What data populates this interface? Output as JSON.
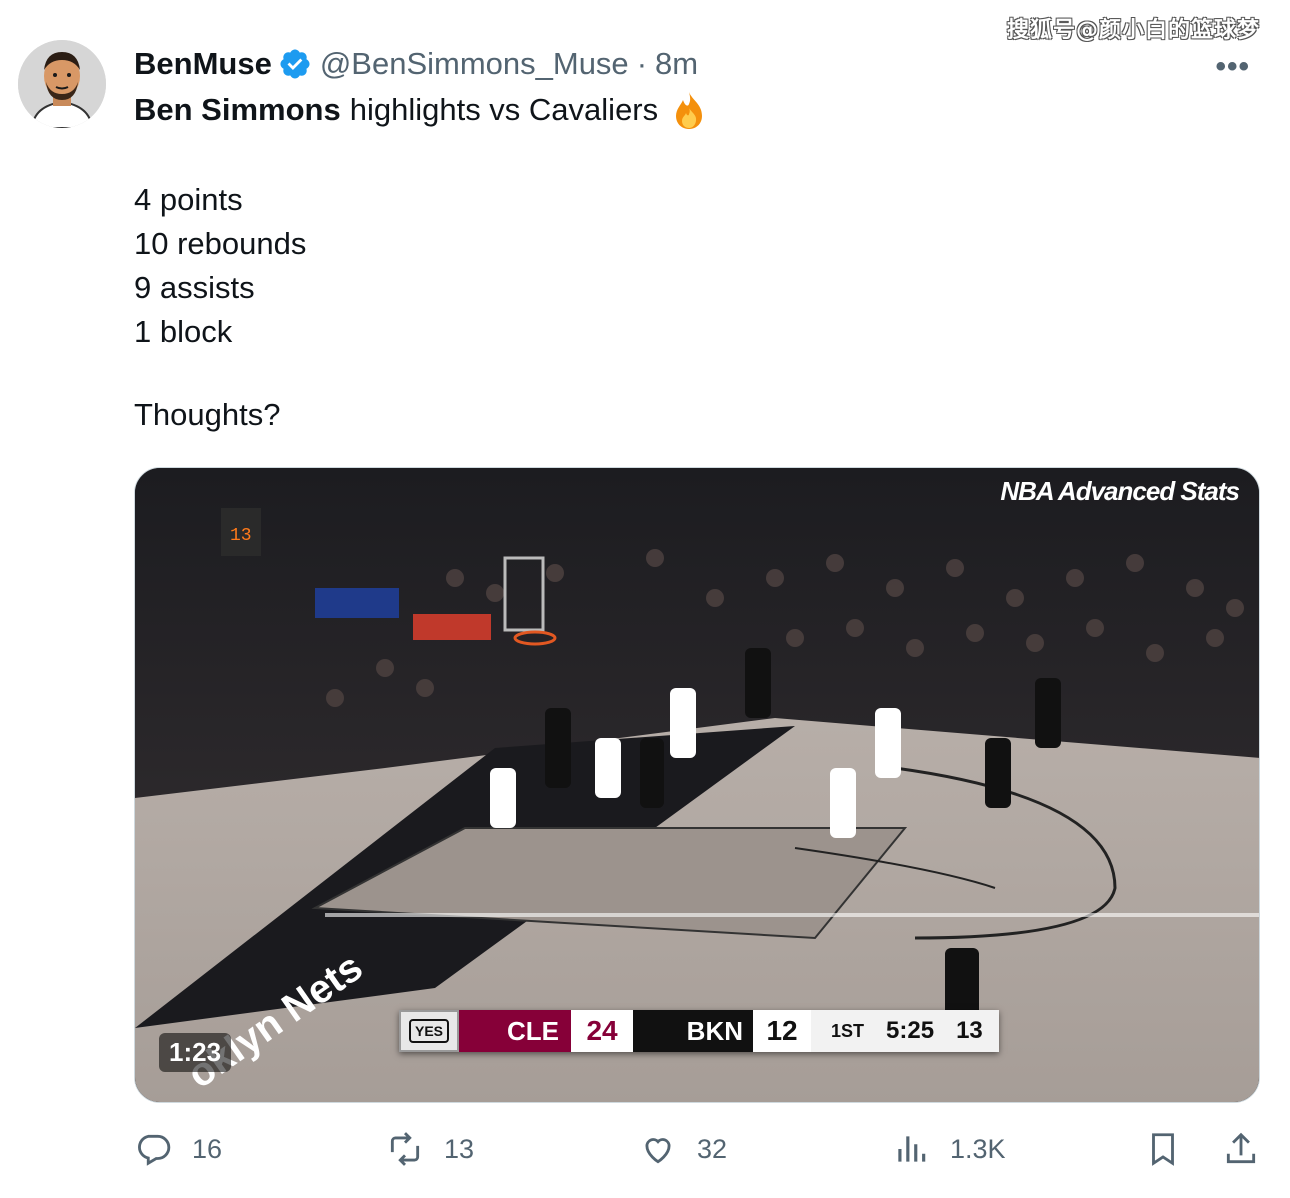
{
  "watermark": "搜狐号@颜小白的篮球梦",
  "tweet": {
    "display_name": "BenMuse",
    "handle": "@BenSimmons_Muse",
    "separator": "·",
    "time": "8m",
    "more": "•••",
    "headline_bold": "Ben Simmons",
    "headline_rest": "highlights vs Cavaliers",
    "stats": [
      "4 points",
      "10 rebounds",
      "9 assists",
      "1 block"
    ],
    "question": "Thoughts?"
  },
  "video": {
    "duration": "1:23",
    "overlay_brand": "NBA Advanced Stats",
    "scorebug": {
      "network": "YES",
      "away_team": "CLE",
      "away_score": "24",
      "home_team": "BKN",
      "home_score": "12",
      "quarter": "1ST",
      "clock": "5:25",
      "shot_clock": "13"
    },
    "court_text": "oklyn Nets"
  },
  "actions": {
    "replies": "16",
    "retweets": "13",
    "likes": "32",
    "views": "1.3K"
  },
  "colors": {
    "verified_blue": "#1d9bf0",
    "cavs_wine": "#860038",
    "muted_text": "#536471"
  },
  "icons": [
    "reply-icon",
    "retweet-icon",
    "like-icon",
    "views-icon",
    "bookmark-icon",
    "share-icon",
    "verified-badge-icon",
    "fire-emoji-icon"
  ]
}
